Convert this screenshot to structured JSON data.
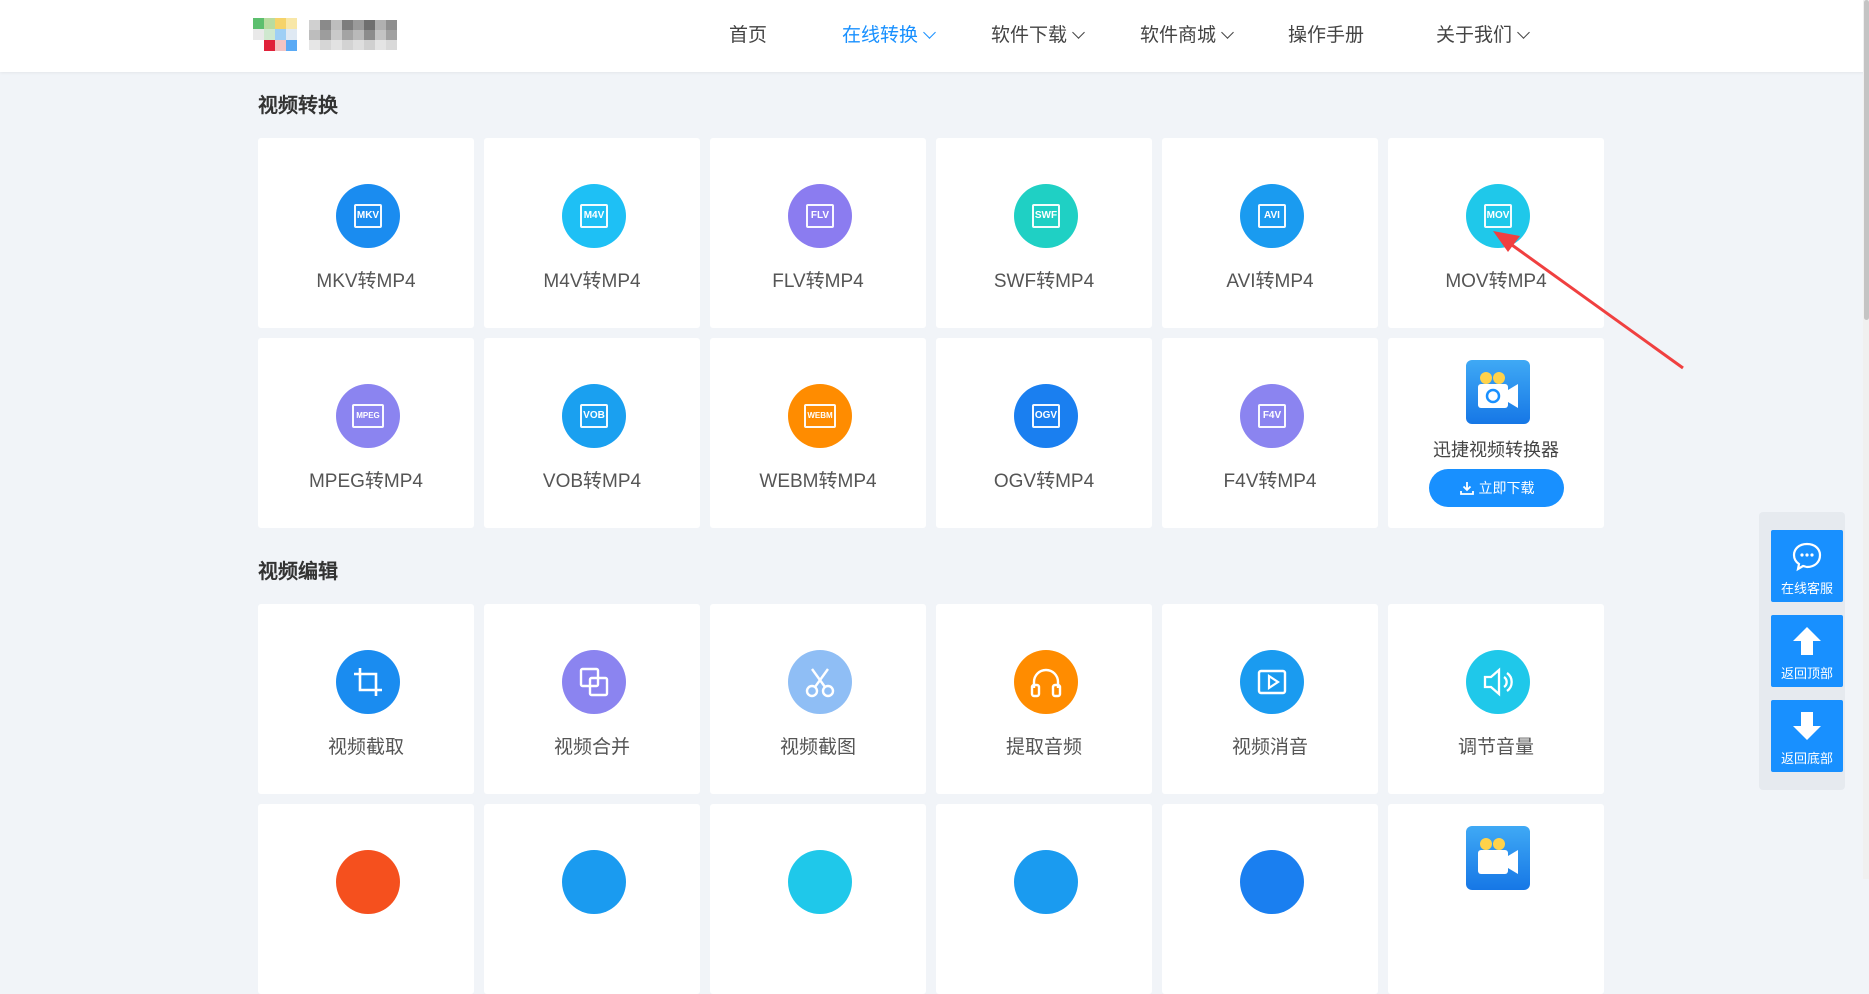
{
  "nav": {
    "items": [
      {
        "label": "首页",
        "active": false,
        "dropdown": false
      },
      {
        "label": "在线转换",
        "active": true,
        "dropdown": true
      },
      {
        "label": "软件下载",
        "active": false,
        "dropdown": true
      },
      {
        "label": "软件商城",
        "active": false,
        "dropdown": true
      },
      {
        "label": "操作手册",
        "active": false,
        "dropdown": false
      },
      {
        "label": "关于我们",
        "active": false,
        "dropdown": true
      }
    ],
    "active_color": "#1890ff"
  },
  "sections": {
    "video_convert": {
      "title": "视频转换",
      "cards": [
        {
          "label": "MKV转MP4",
          "badge": "MKV",
          "color": "#1a8cf0"
        },
        {
          "label": "M4V转MP4",
          "badge": "M4V",
          "color": "#1ec0f5"
        },
        {
          "label": "FLV转MP4",
          "badge": "FLV",
          "color": "#8b7cf0"
        },
        {
          "label": "SWF转MP4",
          "badge": "SWF",
          "color": "#1fd0c4"
        },
        {
          "label": "AVI转MP4",
          "badge": "AVI",
          "color": "#1a9bf0"
        },
        {
          "label": "MOV转MP4",
          "badge": "MOV",
          "color": "#1fc8ea"
        },
        {
          "label": "MPEG转MP4",
          "badge": "MPEG",
          "color": "#8b84f0"
        },
        {
          "label": "VOB转MP4",
          "badge": "VOB",
          "color": "#1aa0f0"
        },
        {
          "label": "WEBM转MP4",
          "badge": "WEBM",
          "color": "#ff8c00"
        },
        {
          "label": "OGV转MP4",
          "badge": "OGV",
          "color": "#1a7ff0"
        },
        {
          "label": "F4V转MP4",
          "badge": "F4V",
          "color": "#8b84f0"
        }
      ],
      "promo": {
        "title": "迅捷视频转换器",
        "button": "立即下载"
      }
    },
    "video_edit": {
      "title": "视频编辑",
      "cards": [
        {
          "label": "视频截取",
          "icon": "crop-icon",
          "color": "#1a8cf0"
        },
        {
          "label": "视频合并",
          "icon": "merge-icon",
          "color": "#8b84f0"
        },
        {
          "label": "视频截图",
          "icon": "scissors-icon",
          "color": "#8fbef5"
        },
        {
          "label": "提取音频",
          "icon": "headphones-icon",
          "color": "#ff8c00"
        },
        {
          "label": "视频消音",
          "icon": "play-icon",
          "color": "#1a9bf0"
        },
        {
          "label": "调节音量",
          "icon": "speaker-icon",
          "color": "#1fc8ea"
        }
      ]
    }
  },
  "float_panel": {
    "buttons": [
      {
        "label": "在线客服",
        "icon": "chat-icon"
      },
      {
        "label": "返回顶部",
        "icon": "arrow-up-icon"
      },
      {
        "label": "返回底部",
        "icon": "arrow-down-icon"
      }
    ]
  }
}
